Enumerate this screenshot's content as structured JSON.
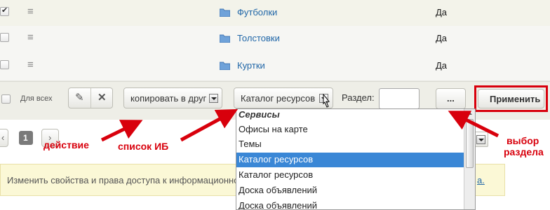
{
  "rows": [
    {
      "name": "Футболки",
      "value": "Да",
      "checked": true
    },
    {
      "name": "Толстовки",
      "value": "Да",
      "checked": false
    },
    {
      "name": "Куртки",
      "value": "Да",
      "checked": false
    }
  ],
  "toolbar": {
    "for_all_label": "Для всех",
    "action_select": "копировать в друг",
    "iblock_select": "Каталог ресурсов",
    "section_label": "Раздел:",
    "section_value": "",
    "browse_label": "...",
    "apply_label": "Применить"
  },
  "pager": {
    "current_page": "1",
    "prev": "‹",
    "next": "›"
  },
  "info": {
    "text": "Изменить свойства и права доступа к информационно",
    "link": "а."
  },
  "dropdown": {
    "group": "Сервисы",
    "items": [
      "Офисы на карте",
      "Темы",
      "Каталог ресурсов",
      "Каталог ресурсов",
      "Доска объявлений",
      "Доска объявлений"
    ],
    "selected_index": 2
  },
  "annotations": {
    "action": "действие",
    "iblock_list": "список ИБ",
    "section_choice_line1": "выбор",
    "section_choice_line2": "раздела"
  },
  "colors": {
    "accent": "#d8000c",
    "link": "#2167a8",
    "selection": "#3a87d6"
  }
}
